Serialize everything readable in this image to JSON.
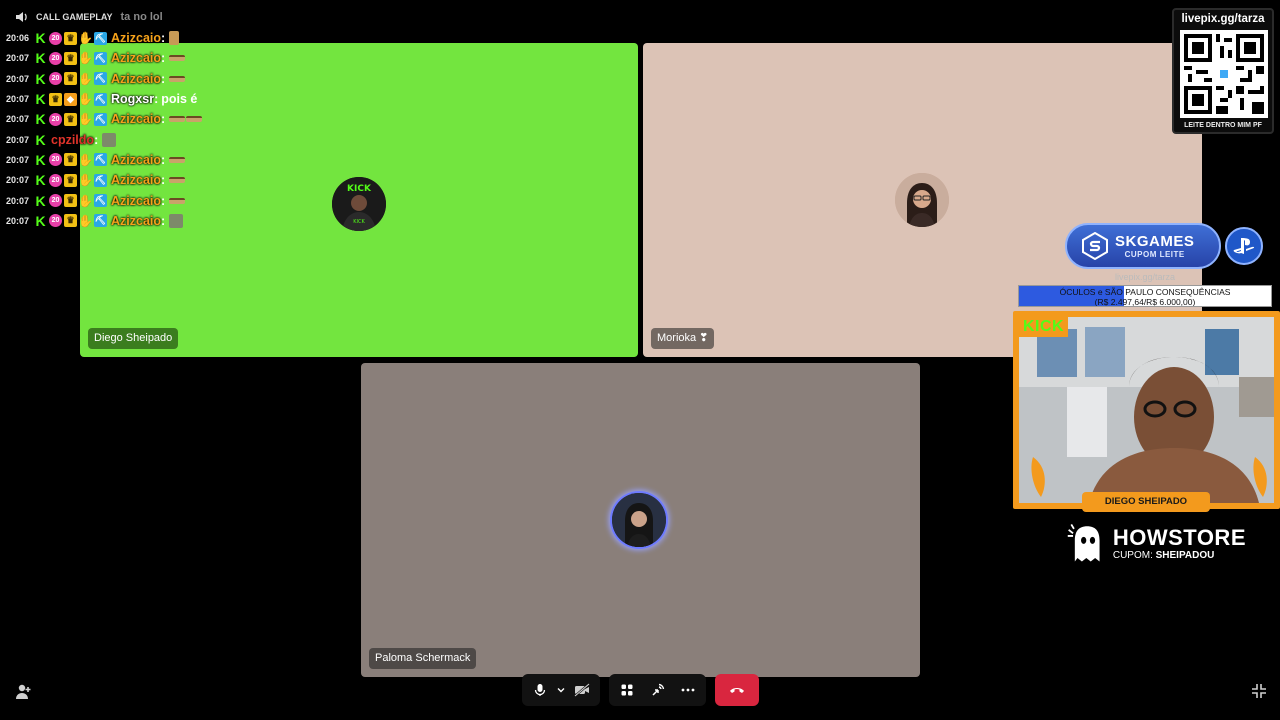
{
  "chat": {
    "top_label": "CALL GAMEPLAY",
    "top_prev": "ta no lol",
    "messages": [
      {
        "time": "20:06",
        "user": "Azizcaio",
        "color": "orange",
        "badges": [
          "kick",
          "sub",
          "crown",
          "hand",
          "pick"
        ],
        "emote": "small",
        "text": ""
      },
      {
        "time": "20:07",
        "user": "Azizcaio",
        "color": "orange",
        "badges": [
          "kick",
          "sub",
          "crown",
          "hand",
          "pick"
        ],
        "emote": "bar",
        "text": ""
      },
      {
        "time": "20:07",
        "user": "Azizcaio",
        "color": "orange",
        "badges": [
          "kick",
          "sub",
          "crown",
          "hand",
          "pick"
        ],
        "emote": "bar",
        "text": ""
      },
      {
        "time": "20:07",
        "user": "Rogxsr",
        "color": "white",
        "badges": [
          "kick",
          "crown",
          "box",
          "hand",
          "pick"
        ],
        "emote": "",
        "text": "pois é"
      },
      {
        "time": "20:07",
        "user": "Azizcaio",
        "color": "orange",
        "badges": [
          "kick",
          "sub",
          "crown",
          "hand",
          "pick"
        ],
        "emote": "bar2",
        "text": ""
      },
      {
        "time": "20:07",
        "user": "cpzildo",
        "color": "red",
        "badges": [
          "kick"
        ],
        "emote": "sq",
        "text": ""
      },
      {
        "time": "20:07",
        "user": "Azizcaio",
        "color": "orange",
        "badges": [
          "kick",
          "sub",
          "crown",
          "hand",
          "pick"
        ],
        "emote": "bar",
        "text": ""
      },
      {
        "time": "20:07",
        "user": "Azizcaio",
        "color": "orange",
        "badges": [
          "kick",
          "sub",
          "crown",
          "hand",
          "pick"
        ],
        "emote": "bar",
        "text": ""
      },
      {
        "time": "20:07",
        "user": "Azizcaio",
        "color": "orange",
        "badges": [
          "kick",
          "sub",
          "crown",
          "hand",
          "pick"
        ],
        "emote": "bar",
        "text": ""
      },
      {
        "time": "20:07",
        "user": "Azizcaio",
        "color": "orange",
        "badges": [
          "kick",
          "sub",
          "crown",
          "hand",
          "pick"
        ],
        "emote": "sq",
        "text": ""
      }
    ]
  },
  "participants": {
    "diego": {
      "name": "Diego Sheipado"
    },
    "morioka": {
      "name": "Morioka ❣"
    },
    "paloma": {
      "name": "Paloma Schermack"
    }
  },
  "controls": {
    "mic": "microphone-icon",
    "mic_menu": "chevron-down-icon",
    "video": "video-off-icon",
    "apps": "apps-icon",
    "stream": "screen-share-icon",
    "more": "more-icon",
    "end": "hang-up-icon"
  },
  "overlay": {
    "qr_url": "livepix.gg/tarza",
    "qr_caption": "LEITE DENTRO MIM PF",
    "sk_title": "SKGAMES",
    "sk_sub": "CUPOM LEITE",
    "livepix_small": "livepix.gg/tarza",
    "goal_line1": "ÓCULOS e SÃO PAULO CONSEQUÊNCIAS",
    "goal_line2": "(R$ 2.497,64/R$ 6.000,00)",
    "goal_progress": 0.416,
    "kick_tag": "KICK",
    "cam_name": "DIEGO SHEIPADO",
    "how_title": "HOWSTORE",
    "how_cupom_label": "CUPOM:",
    "how_cupom_code": "SHEIPADOU"
  },
  "colors": {
    "green_tile": "#73e53f",
    "pink_tile": "#dcc3b6",
    "gray_tile": "#8a7f7a",
    "end_call": "#d9263f",
    "cam_frame": "#f39a1d",
    "kick_green": "#53fc18"
  }
}
